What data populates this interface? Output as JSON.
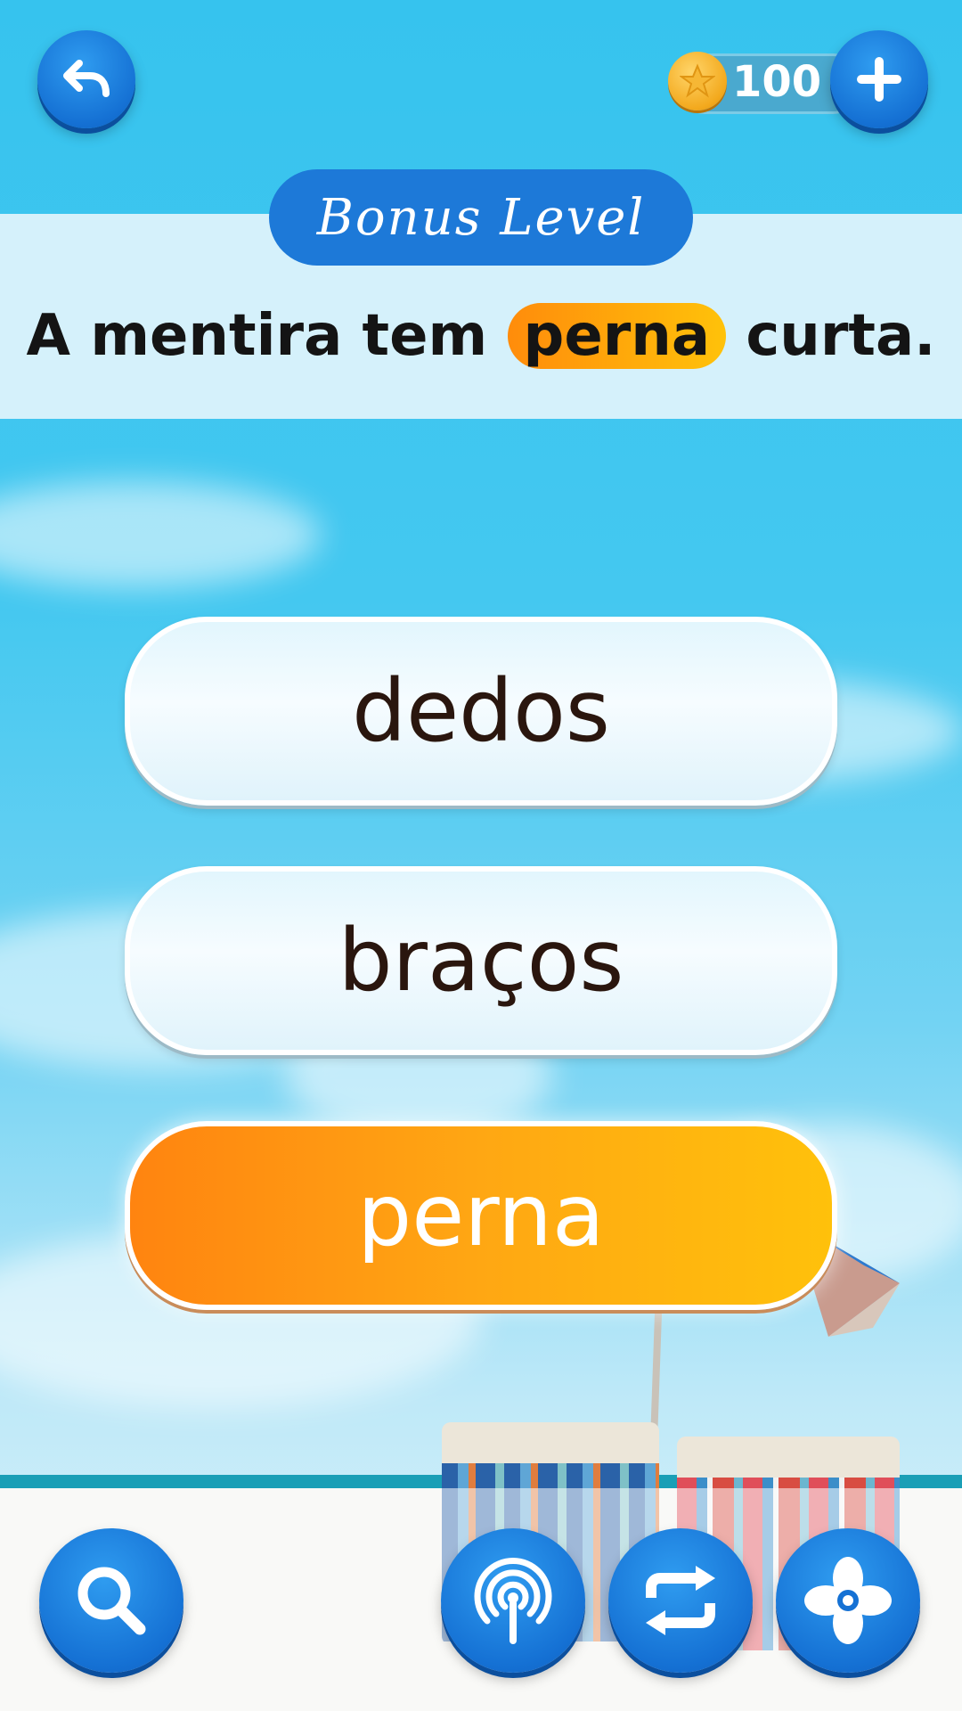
{
  "header": {
    "coins": "100",
    "level_title": "Bonus Level"
  },
  "question": {
    "before": "A mentira tem",
    "highlight": "perna",
    "after": "curta."
  },
  "answers": [
    {
      "label": "dedos",
      "selected": false
    },
    {
      "label": "braços",
      "selected": false
    },
    {
      "label": "perna",
      "selected": true
    }
  ],
  "toolbar": {
    "icons": [
      "search-icon",
      "signal-icon",
      "swap-icon",
      "fan-icon"
    ]
  },
  "colors": {
    "primary_blue": "#1d79d8",
    "selected_orange": "#ff8c0b",
    "selected_yellow": "#ffc20a"
  }
}
